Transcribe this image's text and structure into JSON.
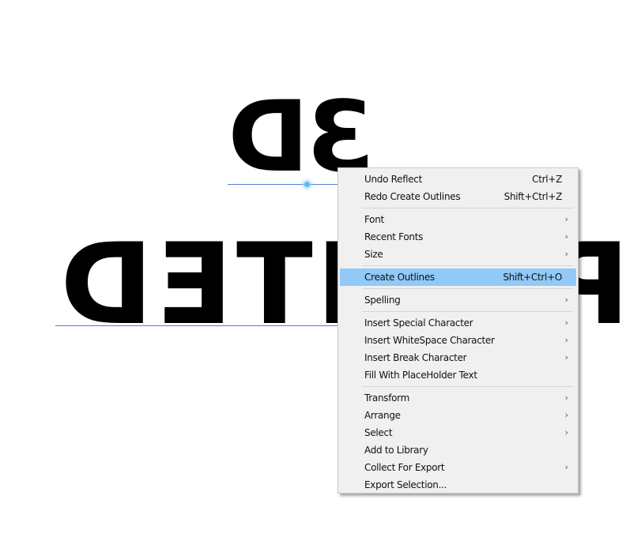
{
  "canvas": {
    "text_line_1": "3D",
    "text_line_2": "PRINTED",
    "mirrored": true
  },
  "context_menu": {
    "groups": [
      [
        {
          "label": "Undo Reflect",
          "shortcut": "Ctrl+Z",
          "submenu": false
        },
        {
          "label": "Redo Create Outlines",
          "shortcut": "Shift+Ctrl+Z",
          "submenu": false
        }
      ],
      [
        {
          "label": "Font",
          "shortcut": "",
          "submenu": true
        },
        {
          "label": "Recent Fonts",
          "shortcut": "",
          "submenu": true
        },
        {
          "label": "Size",
          "shortcut": "",
          "submenu": true
        }
      ],
      [
        {
          "label": "Create Outlines",
          "shortcut": "Shift+Ctrl+O",
          "submenu": false,
          "highlighted": true
        }
      ],
      [
        {
          "label": "Spelling",
          "shortcut": "",
          "submenu": true
        }
      ],
      [
        {
          "label": "Insert Special Character",
          "shortcut": "",
          "submenu": true
        },
        {
          "label": "Insert WhiteSpace Character",
          "shortcut": "",
          "submenu": true
        },
        {
          "label": "Insert Break Character",
          "shortcut": "",
          "submenu": true
        },
        {
          "label": "Fill With PlaceHolder Text",
          "shortcut": "",
          "submenu": false
        }
      ],
      [
        {
          "label": "Transform",
          "shortcut": "",
          "submenu": true
        },
        {
          "label": "Arrange",
          "shortcut": "",
          "submenu": true
        },
        {
          "label": "Select",
          "shortcut": "",
          "submenu": true
        },
        {
          "label": "Add to Library",
          "shortcut": "",
          "submenu": false
        },
        {
          "label": "Collect For Export",
          "shortcut": "",
          "submenu": true
        },
        {
          "label": "Export Selection...",
          "shortcut": "",
          "submenu": false
        }
      ]
    ],
    "submenu_glyph": "›"
  },
  "colors": {
    "highlight": "#91c9f7",
    "menu_bg": "#f0f0f0",
    "baseline": "#4a7fd0"
  }
}
